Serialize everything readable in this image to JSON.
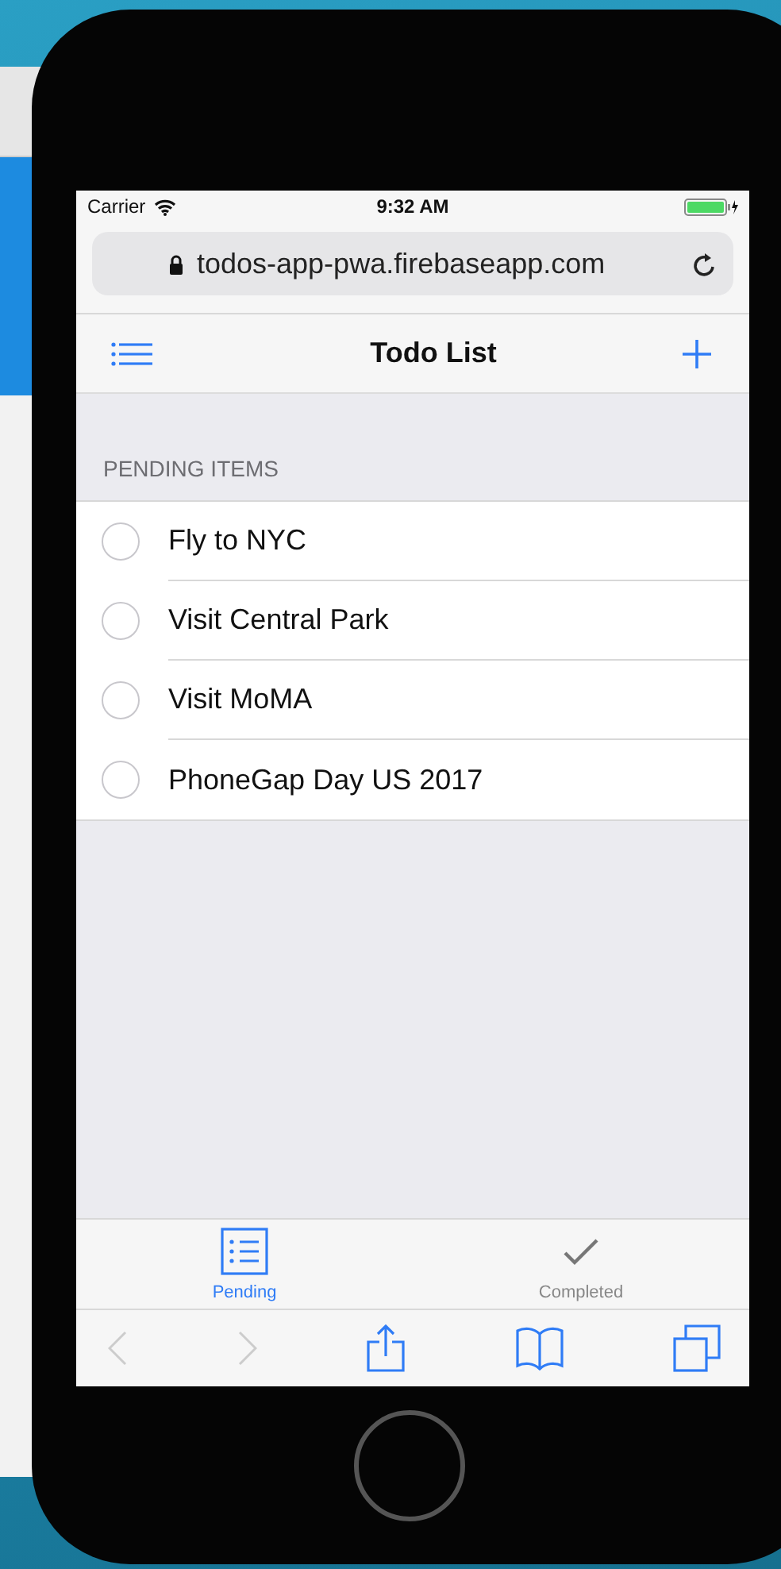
{
  "status_bar": {
    "carrier": "Carrier",
    "time": "9:32 AM"
  },
  "address_bar": {
    "url": "todos-app-pwa.firebaseapp.com"
  },
  "nav_bar": {
    "title": "Todo List"
  },
  "section": {
    "header": "PENDING ITEMS"
  },
  "items": [
    {
      "label": "Fly to NYC",
      "checked": false
    },
    {
      "label": "Visit Central Park",
      "checked": false
    },
    {
      "label": "Visit MoMA",
      "checked": false
    },
    {
      "label": "PhoneGap Day US 2017",
      "checked": false
    }
  ],
  "tabs": [
    {
      "label": "Pending",
      "kind": "list",
      "selected": true
    },
    {
      "label": "Completed",
      "kind": "check",
      "selected": false
    }
  ]
}
